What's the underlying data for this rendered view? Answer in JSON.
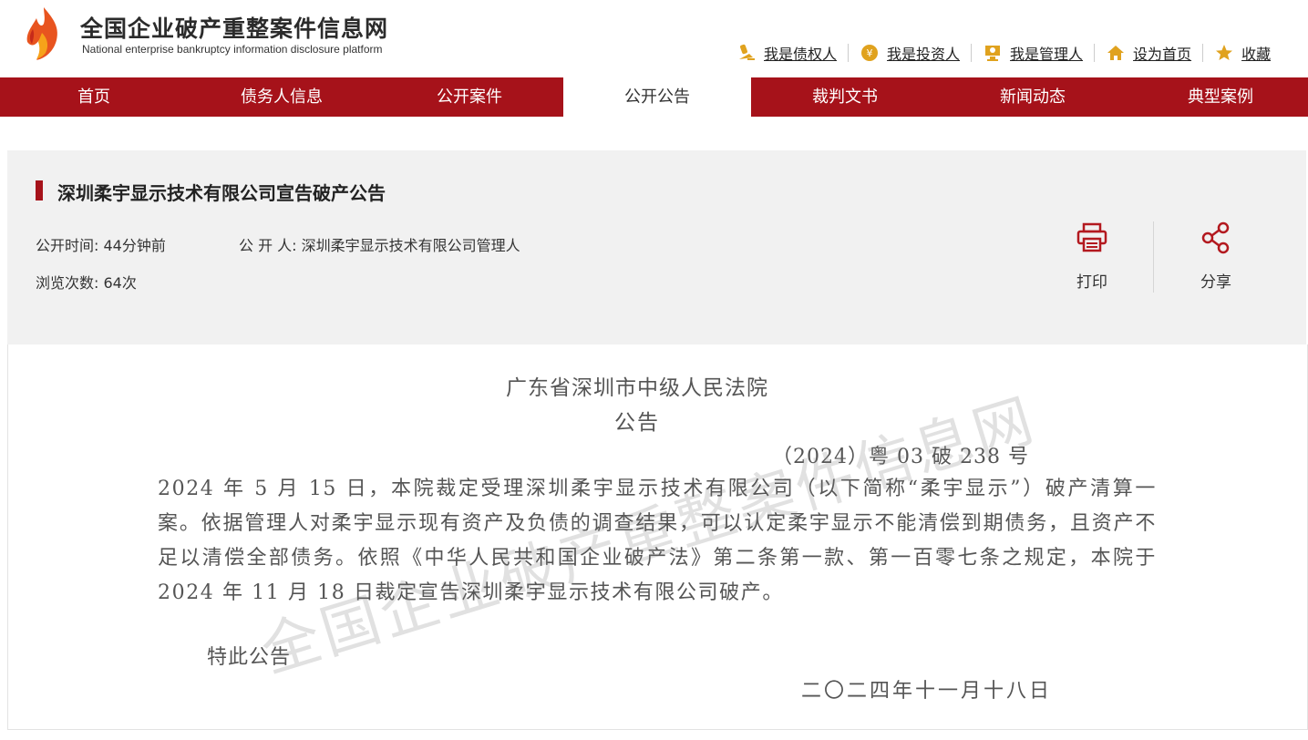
{
  "header": {
    "site_title": "全国企业破产重整案件信息网",
    "site_subtitle": "National enterprise bankruptcy  information disclosure platform",
    "links": [
      {
        "label": "我是债权人",
        "icon": "creditor-icon"
      },
      {
        "label": "我是投资人",
        "icon": "investor-icon"
      },
      {
        "label": "我是管理人",
        "icon": "manager-icon"
      },
      {
        "label": "设为首页",
        "icon": "home-icon"
      },
      {
        "label": "收藏",
        "icon": "star-icon"
      }
    ]
  },
  "nav": {
    "items": [
      {
        "label": "首页"
      },
      {
        "label": "债务人信息"
      },
      {
        "label": "公开案件"
      },
      {
        "label": "公开公告",
        "active": true
      },
      {
        "label": "裁判文书"
      },
      {
        "label": "新闻动态"
      },
      {
        "label": "典型案例"
      }
    ]
  },
  "notice": {
    "title": "深圳柔宇显示技术有限公司宣告破产公告",
    "publish_time_label": "公开时间:",
    "publish_time": "44分钟前",
    "publisher_label": "公 开 人:",
    "publisher": "深圳柔宇显示技术有限公司管理人",
    "views_label": "浏览次数:",
    "views": "64次",
    "print_label": "打印",
    "share_label": "分享"
  },
  "document": {
    "court": "广东省深圳市中级人民法院",
    "heading": "公告",
    "case_no": "（2024）粤 03 破 238 号",
    "body": "2024 年 5 月 15 日，本院裁定受理深圳柔宇显示技术有限公司（以下简称“柔宇显示”）破产清算一案。依据管理人对柔宇显示现有资产及负债的调查结果，可以认定柔宇显示不能清偿到期债务，且资产不足以清偿全部债务。依照《中华人民共和国企业破产法》第二条第一款、第一百零七条之规定，本院于 2024 年 11 月 18 日裁定宣告深圳柔宇显示技术有限公司破产。",
    "closing": "特此公告",
    "date": "二〇二四年十一月十八日",
    "watermark": "全国企业破产重整案件信息网"
  },
  "colors": {
    "brand_red": "#a6121a",
    "panel_gray": "#f1f1f1"
  }
}
